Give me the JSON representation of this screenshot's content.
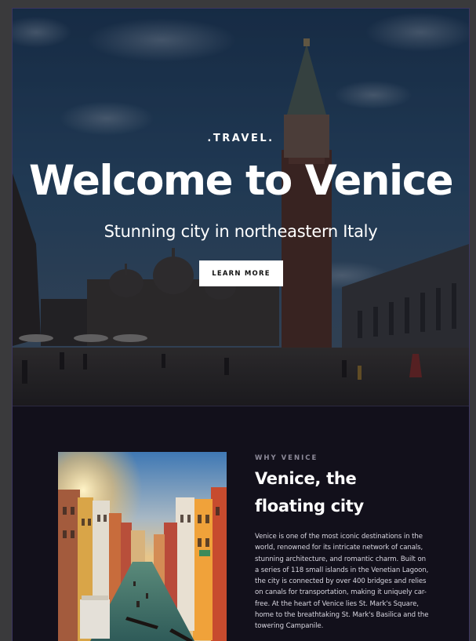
{
  "hero": {
    "eyebrow": ".TRAVEL.",
    "title": "Welcome to Venice",
    "subtitle": "Stunning city in northeastern Italy",
    "cta_label": "LEARN MORE"
  },
  "intro": {
    "kicker": "WHY VENICE",
    "title_line1": "Venice, the",
    "title_line2": "floating city",
    "body": "Venice is one of the most iconic destinations in the world, renowned for its intricate network of canals, stunning architecture, and romantic charm. Built on a series of 118 small islands in the Venetian Lagoon, the city is connected by over 400 bridges and relies on canals for transportation, making it uniquely car-free. At the heart of Venice lies St. Mark's Square, home to the breathtaking St. Mark's Basilica and the towering Campanile."
  },
  "colors": {
    "page_bg": "#12101b",
    "hero_text": "#ffffff",
    "button_bg": "#ffffff",
    "kicker_text": "#8d8a99"
  }
}
